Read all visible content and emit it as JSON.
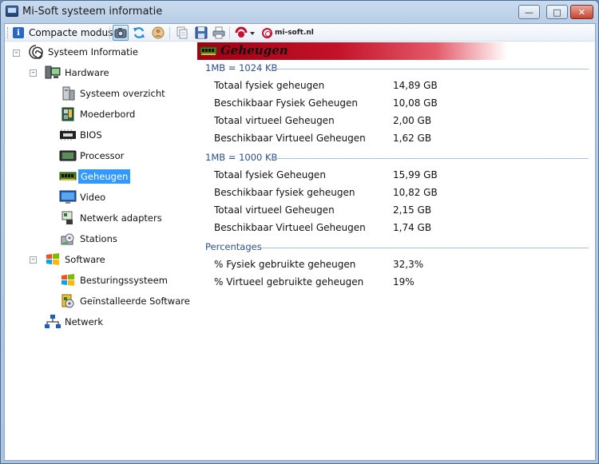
{
  "window": {
    "title": "Mi-Soft systeem informatie"
  },
  "toolbar": {
    "compact_label": "Compacte modus",
    "brand_text": "mi-soft.nl"
  },
  "tree": {
    "root": "Systeem Informatie",
    "hardware": "Hardware",
    "hardware_items": [
      "Systeem overzicht",
      "Moederbord",
      "BIOS",
      "Processor",
      "Geheugen",
      "Video",
      "Netwerk adapters",
      "Stations"
    ],
    "software": "Software",
    "software_items": [
      "Besturingssysteem",
      "Geïnstalleerde Software"
    ],
    "network": "Netwerk",
    "selected": "Geheugen"
  },
  "content": {
    "title": "Geheugen",
    "sections": [
      {
        "heading": "1MB = 1024 KB",
        "rows": [
          {
            "label": "Totaal fysiek geheugen",
            "value": "14,89 GB"
          },
          {
            "label": "Beschikbaar Fysiek Geheugen",
            "value": "10,08 GB"
          },
          {
            "label": "Totaal virtueel Geheugen",
            "value": "2,00 GB"
          },
          {
            "label": "Beschikbaar Virtueel Geheugen",
            "value": "1,62 GB"
          }
        ]
      },
      {
        "heading": "1MB = 1000 KB",
        "rows": [
          {
            "label": "Totaal fysiek Geheugen",
            "value": "15,99 GB"
          },
          {
            "label": "Beschikbaar fysiek geheugen",
            "value": "10,82 GB"
          },
          {
            "label": "Totaal virtueel Geheugen",
            "value": "2,15 GB"
          },
          {
            "label": "Beschikbaar Virtueel Geheugen",
            "value": "1,74 GB"
          }
        ]
      },
      {
        "heading": "Percentages",
        "rows": [
          {
            "label": "% Fysiek gebruikte geheugen",
            "value": "32,3%"
          },
          {
            "label": "% Virtueel gebruikte geheugen",
            "value": "19%"
          }
        ]
      }
    ]
  },
  "colors": {
    "header_gradient_start": "#a00012",
    "selection": "#3399ff",
    "section_heading": "#2b4f86"
  }
}
